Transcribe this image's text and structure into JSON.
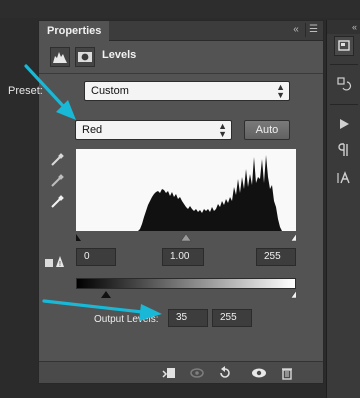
{
  "panel": {
    "tab_label": "Properties",
    "title": "Levels",
    "preset_label": "Preset:",
    "preset_value": "Custom",
    "channel_value": "Red",
    "auto_label": "Auto",
    "input_levels": {
      "black": "0",
      "gamma": "1.00",
      "white": "255"
    },
    "output_label": "Output Levels:",
    "output_levels": {
      "black": "35",
      "white": "255"
    }
  },
  "header_buttons": {
    "collapse": "«",
    "close": "×",
    "menu": "☰"
  },
  "colors": {
    "panel_bg": "#535353",
    "accent_arrow": "#19b8d6"
  }
}
